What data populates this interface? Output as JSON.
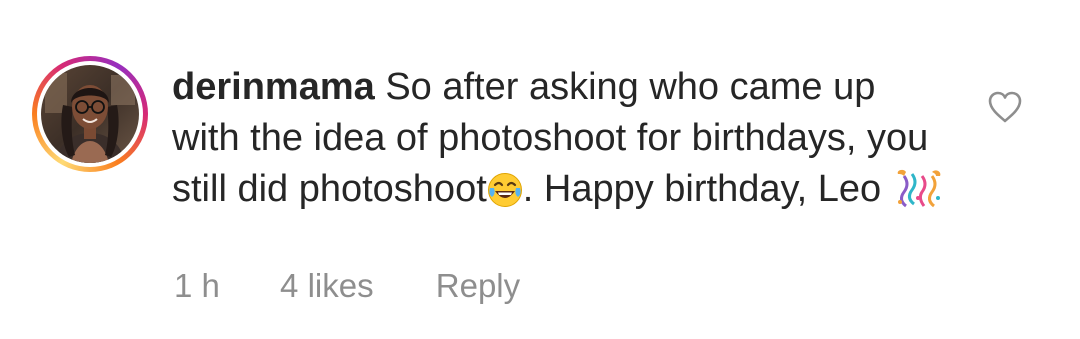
{
  "comment": {
    "username": "derinmama",
    "text_segments": [
      "So after asking who came up with the idea of photoshoot for birthdays, you still did photoshoot",
      ". Happy birthday, Leo "
    ],
    "emojis": [
      "tears-of-joy-emoji",
      "confetti-ball-emoji"
    ],
    "time": "1 h",
    "likes": "4 likes",
    "reply_label": "Reply",
    "liked": false,
    "story_ring_colors": [
      "#feda75",
      "#fa7e1e",
      "#d62976",
      "#962fbf"
    ],
    "text_color": "#262626",
    "meta_color": "#8e8e8e"
  }
}
